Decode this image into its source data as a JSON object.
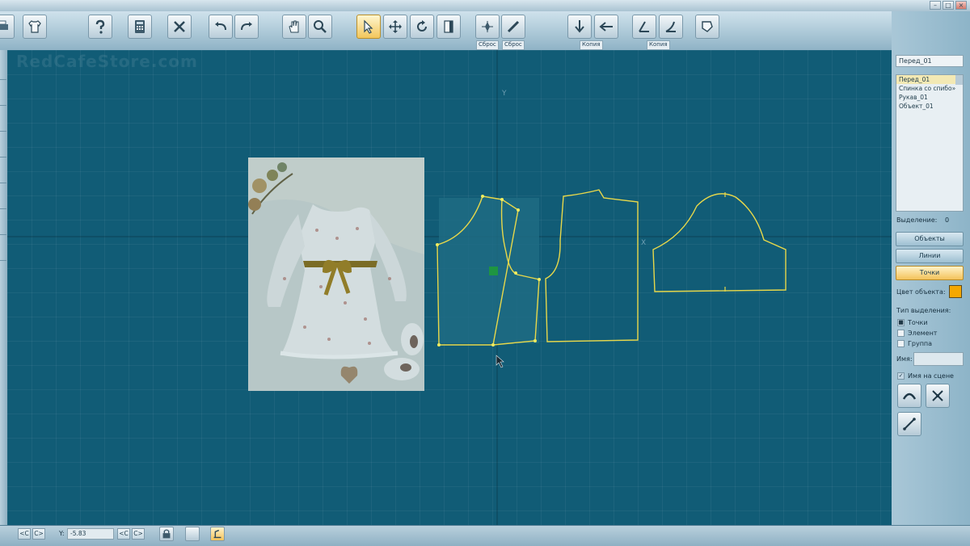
{
  "window": {
    "controls": [
      {
        "name": "minimize-button",
        "label": "–"
      },
      {
        "name": "maximize-button",
        "label": "□"
      },
      {
        "name": "close-button",
        "label": "×"
      }
    ]
  },
  "toolbar": {
    "labels": {
      "reset_1": "Сброс",
      "reset_2": "Сброс",
      "copy_1": "Копия",
      "copy_2": "Копия"
    },
    "active_tool": "select-arrow"
  },
  "watermark": "RedCafeStore.com",
  "canvas": {
    "axis_y_label": "Y",
    "axis_x_label": "X"
  },
  "right_panel": {
    "selected_name": "Перед_01",
    "objects": [
      {
        "label": "Перед_01",
        "selected": true
      },
      {
        "label": "Спинка со спибо»",
        "selected": false
      },
      {
        "label": "Рукав_01",
        "selected": false
      },
      {
        "label": "Объект_01",
        "selected": false
      }
    ],
    "selection_label": "Выделение:",
    "selection_count": "0",
    "buttons": {
      "objects": "Объекты",
      "lines": "Линии",
      "points": "Точки"
    },
    "active_button": "points",
    "color_label": "Цвет объекта:",
    "object_color": "#f5a800",
    "selection_type_label": "Тип выделения:",
    "selection_types": [
      {
        "label": "Точки",
        "checked": true
      },
      {
        "label": "Элемент",
        "checked": false
      },
      {
        "label": "Группа",
        "checked": false
      }
    ],
    "name_label": "Имя:",
    "name_value": "",
    "name_on_scene_label": "Имя на сцене",
    "name_on_scene_checked": true
  },
  "status_bar": {
    "prev_label": "<C",
    "next_label": "C>",
    "y_label": "Y:",
    "y_value": "-5.83",
    "prev2_label": "<C",
    "next2_label": "C>"
  },
  "colors": {
    "canvas_bg": "#115c76",
    "pattern_line": "#e8d84a",
    "point": "#f0ec60",
    "highlight": "#1e6b84"
  }
}
